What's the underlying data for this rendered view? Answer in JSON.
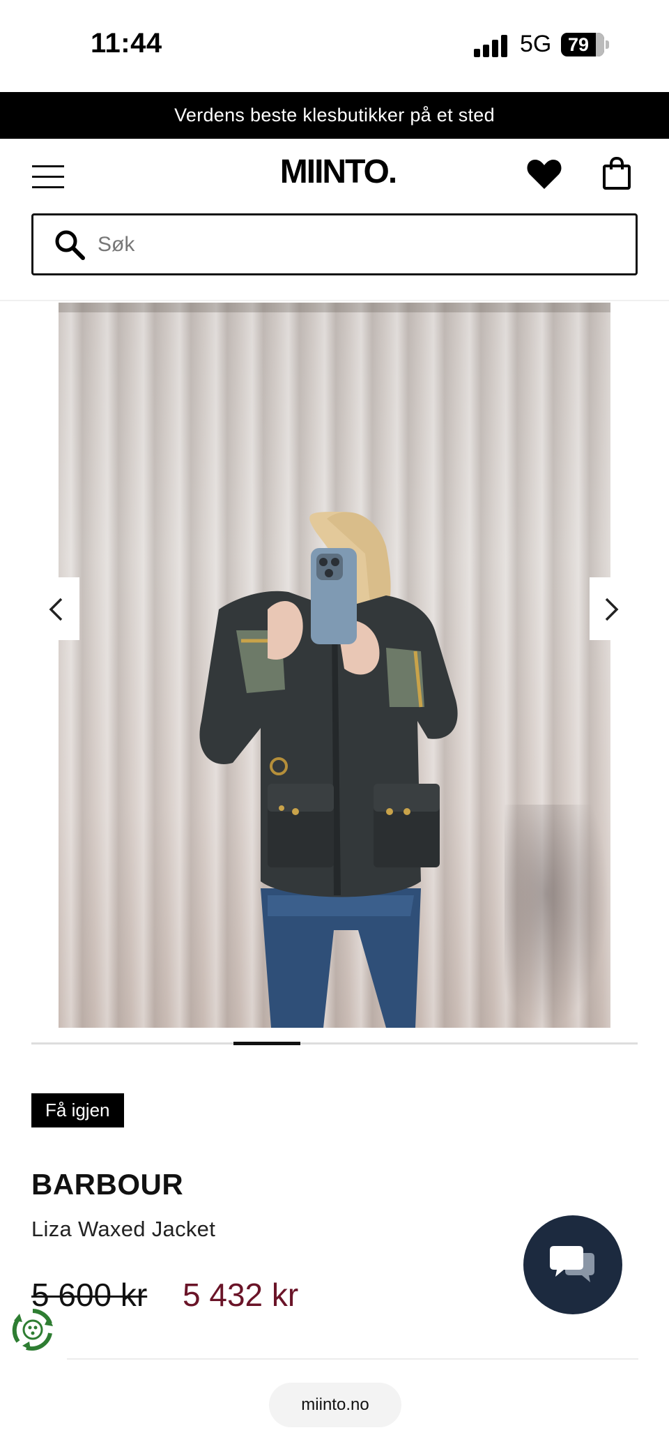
{
  "status_bar": {
    "time": "11:44",
    "network": "5G",
    "battery": "79"
  },
  "promo_banner": {
    "text": "Verdens beste klesbutikker på et sted"
  },
  "header": {
    "logo": "MIINTO.",
    "menu_icon": "hamburger-menu-icon",
    "wishlist_icon": "heart-icon",
    "cart_icon": "shopping-bag-icon"
  },
  "search": {
    "placeholder": "Søk",
    "value": "",
    "icon": "search-icon"
  },
  "gallery": {
    "image_description_icon": "product-photo",
    "prev_icon": "chevron-left-icon",
    "next_icon": "chevron-right-icon",
    "active_index_fraction": 0.333
  },
  "product": {
    "badge": "Få igjen",
    "brand": "BARBOUR",
    "name": "Liza Waxed Jacket",
    "price_old": "5 600 kr",
    "price_new": "5 432 kr"
  },
  "chat": {
    "icon": "chat-bubbles-icon"
  },
  "browser": {
    "url": "miinto.no"
  },
  "colors": {
    "banner_bg": "#000000",
    "sale_price": "#6a1428",
    "chat_bg": "#1c2a3f",
    "eco_green": "#2e7d32"
  }
}
